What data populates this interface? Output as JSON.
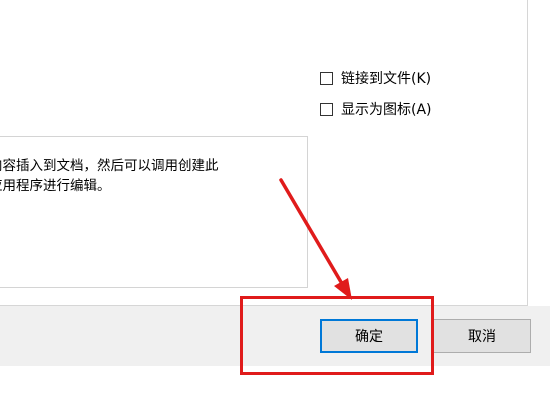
{
  "options": {
    "link_to_file": "链接到文件(K)",
    "display_as_icon": "显示为图标(A)"
  },
  "result": {
    "line1": "内容插入到文档，然后可以调用创建此",
    "line2": "应用程序进行编辑。"
  },
  "buttons": {
    "ok_label": "确定",
    "cancel_label": "取消"
  },
  "annotation": {
    "color": "#e01b1b"
  },
  "colors": {
    "focus_border": "#0078d7",
    "footer_bg": "#f0f0f0"
  }
}
